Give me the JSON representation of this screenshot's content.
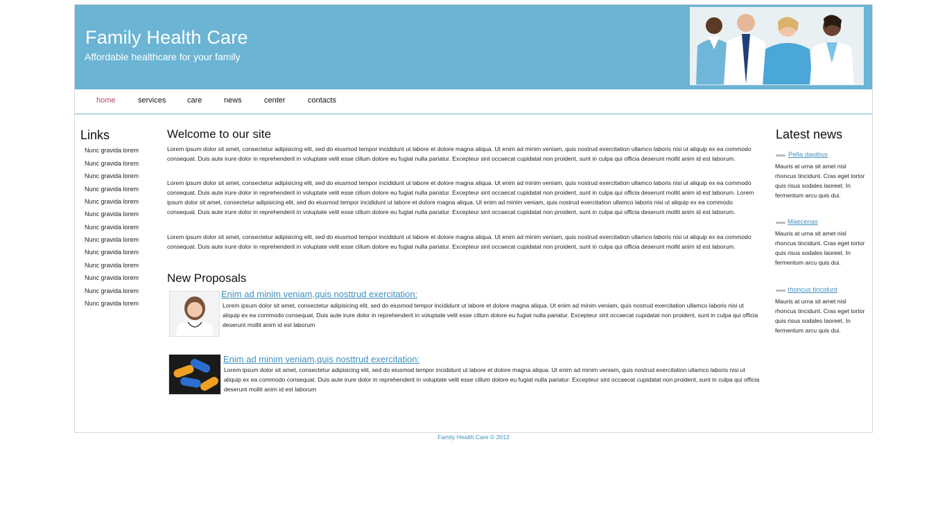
{
  "header": {
    "title": "Family Health Care",
    "tagline": "Affordable healthcare for your family"
  },
  "nav": [
    {
      "label": "home",
      "active": true
    },
    {
      "label": "services"
    },
    {
      "label": "care"
    },
    {
      "label": "news"
    },
    {
      "label": "center"
    },
    {
      "label": "contacts"
    }
  ],
  "links": {
    "title": "Links",
    "items": [
      "Nunc gravida lorem",
      "Nunc gravida lorem",
      "Nunc gravida lorem",
      "Nunc gravida lorem",
      "Nunc gravida lorem",
      "Nunc gravida lorem",
      "Nunc gravida lorem",
      "Nunc gravida lorem",
      "Nunc gravida lorem",
      "Nunc gravida lorem",
      "Nunc gravida lorem",
      "Nunc gravida lorem",
      "Nunc gravida lorem"
    ]
  },
  "welcome": {
    "title": "Welcome to our site",
    "paragraphs": [
      "Lorem ipsum dolor sit amet, consectetur adipisicing elit, sed do eiusmod tempor incididunt ut labore et dolore magna aliqua. Ut enim ad minim veniam, quis nostrud exercitation ullamco laboris nisi ut aliquip ex ea commodo consequat. Duis aute irure dolor in reprehenderit in voluptate velit esse cillum dolore eu fugiat nulla pariatur. Excepteur sint occaecat cupidatat non proident, sunt in culpa qui officia deserunt mollit anim id est laborum.",
      "Lorem ipsum dolor sit amet, consectetur adipisicing elit, sed do eiusmod tempor incididunt ut labore et dolore magna aliqua. Ut enim ad minim veniam, quis nostrud exercitation ullamco laboris nisi ut aliquip ex ea commodo consequat. Duis aute irure dolor in reprehenderit in voluptate velit esse cillum dolore eu fugiat nulla pariatur. Excepteur sint occaecat cupidatat non proident, sunt in culpa qui officia deserunt mollit anim id est laborum. Lorem ipsum dolor sit amet, consectetur adipisicing elit, sed do eiusmod tempor incididunt ut labore et dolore magna aliqua. Ut enim ad minim veniam, quis nostrud exercitation ullamco laboris nisi ut aliquip ex ea commodo consequat. Duis aute irure dolor in reprehenderit in voluptate velit esse cillum dolore eu fugiat nulla pariatur. Excepteur sint occaecat cupidatat non proident, sunt in culpa qui officia deserunt mollit anim id est laborum.",
      "Lorem ipsum dolor sit amet, consectetur adipisicing elit, sed do eiusmod tempor incididunt ut labore et dolore magna aliqua. Ut enim ad minim veniam, quis nostrud exercitation ullamco laboris nisi ut aliquip ex ea commodo consequat. Duis aute irure dolor in reprehenderit in voluptate velit esse cillum dolore eu fugiat nulla pariatur. Excepteur sint occaecat cupidatat non proident, sunt in culpa qui officia deserunt mollit anim id est laborum."
    ]
  },
  "proposals": {
    "title": "New Proposals",
    "items": [
      {
        "link": "Enim ad minim veniam,quis nosttrud exercitation:",
        "text": "Lorem ipsum dolor sit amet, consectetur adipisicing elit, sed do eiusmod tempor incididunt ut labore et dolore magna aliqua. Ut enim ad minim veniam, quis nostrud exercitation ullamco laboris nisi ut aliquip ex ea commodo consequat. Duis aute irure dolor in reprehenderit in voluptate velit esse cillum dolore eu fugiat nulla pariatur. Excepteur sint occaecat cupidatat non proident, sunt in culpa qui officia deserunt mollit anim id est laborum"
      },
      {
        "link": "Enim ad minim veniam,quis nosttrud exercitation: ",
        "text": "Lorem ipsum dolor sit amet, consectetur adipisicing elit, sed do eiusmod tempor incididunt ut labore et dolore magna aliqua. Ut enim ad minim veniam, quis nostrud exercitation ullamco laboris nisi ut aliquip ex ea commodo consequat. Duis aute irure dolor in reprehenderit in voluptate velit esse cillum dolore eu fugiat nulla pariatur. Excepteur sint occaecat cupidatat non proident, sunt in culpa qui officia deserunt mollit anim id est laborum"
      }
    ]
  },
  "news": {
    "title": "Latest news",
    "items": [
      {
        "link": "Pella dapibus",
        "text": "Mauris at urna sit amet nisl rhoncus tincidunt. Cras eget tortor quis risus sodales laoreet. In fermentum arcu quis dui."
      },
      {
        "link": "Maecenas",
        "text": "Mauris at urna sit amet nisl rhoncus tincidunt. Cras eget tortor quis risus sodales laoreet. In fermentum arcu quis dui."
      },
      {
        "link": "rhoncus tincidunt",
        "text": "Mauris at urna sit amet nisl rhoncus tincidunt. Cras eget tortor quis risus sodales laoreet. In fermentum arcu quis dui."
      }
    ]
  },
  "footer": {
    "text": "Family Health Care © 2012"
  },
  "colors": {
    "header_bg": "#6bb4d4",
    "active_nav": "#c33d6f",
    "link": "#3f8fbd"
  }
}
